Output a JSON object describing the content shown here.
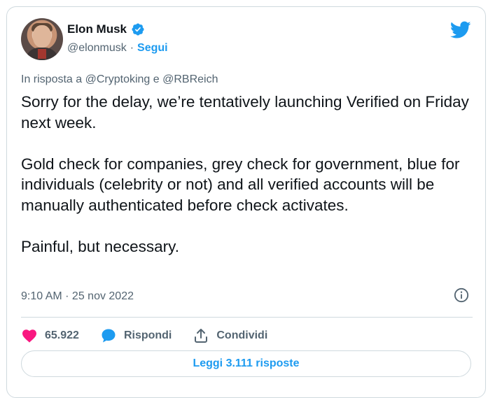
{
  "author": {
    "name": "Elon Musk",
    "handle": "@elonmusk",
    "separator": "·",
    "follow_label": "Segui"
  },
  "tweet": {
    "reply_to": "In risposta a @Cryptoking e @RBReich",
    "text": "Sorry for the delay, we’re tentatively launching Verified on Friday next week.\n\nGold check for companies, grey check for government, blue for individuals (celebrity or not) and all verified accounts will be manually authenticated before check activates.\n\nPainful, but necessary.",
    "timestamp": "9:10 AM · 25 nov 2022"
  },
  "actions": {
    "likes": "65.922",
    "reply_label": "Rispondi",
    "share_label": "Condividi"
  },
  "read_replies_label": "Leggi 3.111 risposte",
  "icons": {
    "verified": "verified-badge-icon",
    "brand": "twitter-bird-icon",
    "info": "info-icon",
    "like": "heart-icon",
    "reply": "speech-bubble-icon",
    "share": "share-upload-icon"
  },
  "colors": {
    "brand_blue": "#1d9bf0",
    "like_pink": "#f91880",
    "muted_text": "#536471",
    "border": "#cfd9de"
  }
}
